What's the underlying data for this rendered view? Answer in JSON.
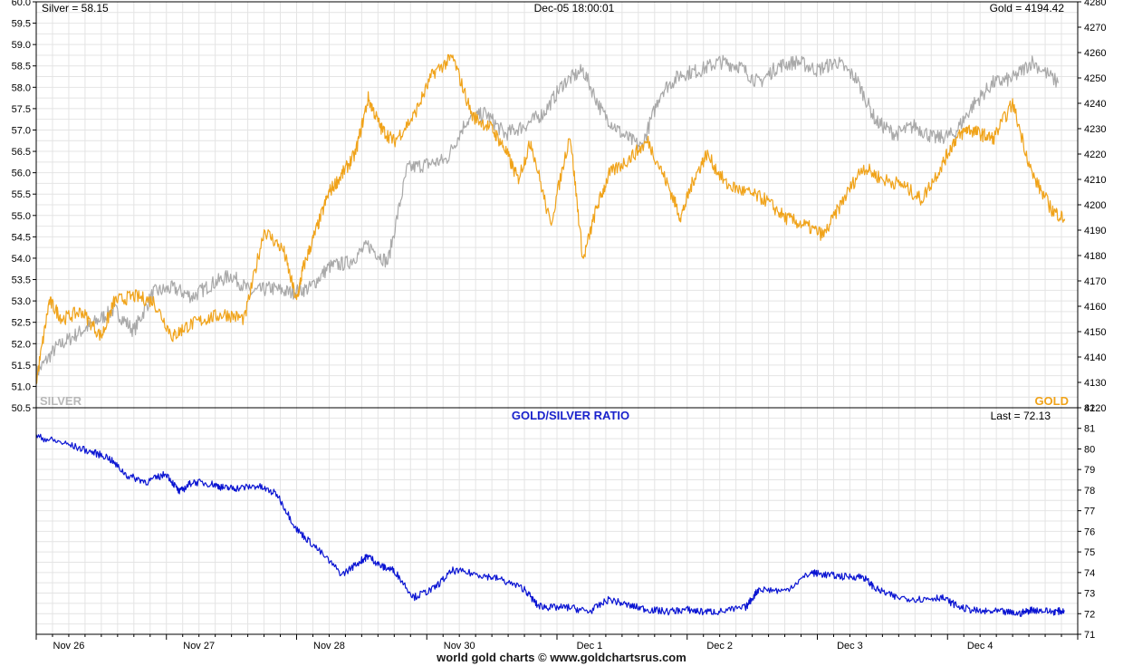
{
  "header": {
    "silver_readout": "Silver = 58.15",
    "timestamp": "Dec-05  18:00:01",
    "gold_readout": "Gold = 4194.42"
  },
  "footer": {
    "credit": "world gold charts © www.goldchartsrus.com"
  },
  "colors": {
    "silver": "#a9a9a9",
    "gold": "#f0a31a",
    "ratio": "#0a14d2",
    "ratio_title": "#1a22cc",
    "grid": "#e4e4e4"
  },
  "chart_data": [
    {
      "type": "line",
      "series": [
        {
          "name": "SILVER",
          "axis": "left",
          "x": [
            0,
            0.15,
            0.3,
            0.45,
            0.6,
            0.75,
            0.9,
            1.05,
            1.2,
            1.35,
            1.5,
            1.65,
            1.8,
            1.95,
            2.1,
            2.25,
            2.4,
            2.55,
            2.7,
            2.85,
            3.0,
            3.15,
            3.3,
            3.45,
            3.6,
            3.75,
            3.9,
            4.05,
            4.2,
            4.35,
            4.5,
            4.65,
            4.8,
            4.95,
            5.1,
            5.25,
            5.4,
            5.55,
            5.7,
            5.85,
            6.0,
            6.15,
            6.3,
            6.45,
            6.6,
            6.75,
            6.9,
            7.05,
            7.2,
            7.35,
            7.5,
            7.65,
            7.85
          ],
          "values": [
            51.3,
            51.9,
            52.2,
            52.5,
            52.8,
            52.3,
            53.2,
            53.3,
            53.1,
            53.4,
            53.6,
            53.2,
            53.3,
            53.2,
            53.3,
            53.8,
            53.9,
            54.3,
            53.9,
            56.1,
            56.2,
            56.3,
            57.2,
            57.4,
            56.9,
            57.1,
            57.4,
            58.1,
            58.4,
            57.4,
            56.9,
            56.6,
            57.9,
            58.3,
            58.4,
            58.6,
            58.5,
            58.1,
            58.5,
            58.6,
            58.4,
            58.6,
            58.2,
            57.2,
            56.9,
            57.1,
            56.8,
            56.9,
            57.6,
            58.1,
            58.2,
            58.6,
            58.1
          ]
        },
        {
          "name": "GOLD",
          "axis": "right",
          "x": [
            0,
            0.1,
            0.2,
            0.35,
            0.5,
            0.6,
            0.75,
            0.9,
            1.05,
            1.15,
            1.3,
            1.45,
            1.6,
            1.75,
            1.9,
            2.0,
            2.05,
            2.15,
            2.25,
            2.35,
            2.45,
            2.55,
            2.65,
            2.75,
            2.9,
            3.05,
            3.2,
            3.35,
            3.5,
            3.6,
            3.7,
            3.8,
            3.95,
            4.1,
            4.2,
            4.3,
            4.4,
            4.55,
            4.7,
            4.85,
            4.95,
            5.05,
            5.15,
            5.3,
            5.45,
            5.6,
            5.75,
            5.9,
            6.05,
            6.2,
            6.35,
            6.5,
            6.65,
            6.8,
            6.95,
            7.05,
            7.15,
            7.25,
            7.35,
            7.5,
            7.65,
            7.8,
            7.9
          ],
          "values": [
            4130,
            4162,
            4155,
            4158,
            4148,
            4162,
            4164,
            4162,
            4148,
            4152,
            4155,
            4157,
            4155,
            4190,
            4182,
            4162,
            4175,
            4190,
            4205,
            4212,
            4220,
            4242,
            4230,
            4225,
            4235,
            4252,
            4258,
            4235,
            4230,
            4222,
            4210,
            4225,
            4192,
            4228,
            4178,
            4198,
            4212,
            4218,
            4225,
            4208,
            4195,
            4210,
            4220,
            4208,
            4205,
            4202,
            4195,
            4192,
            4188,
            4202,
            4215,
            4210,
            4208,
            4202,
            4215,
            4225,
            4230,
            4228,
            4226,
            4240,
            4212,
            4198,
            4194.42
          ]
        }
      ],
      "series_labels": {
        "left": "SILVER",
        "right": "GOLD"
      },
      "x_start": "Nov 26",
      "x_ticks": [
        "Nov 26",
        "Nov 27",
        "Nov 28",
        "Nov 30",
        "Dec 1",
        "Dec 2",
        "Dec 3",
        "Dec 4"
      ],
      "x_range": [
        0,
        8
      ],
      "ylim_left": [
        50.5,
        60.0
      ],
      "ylim_right": [
        4120,
        4280
      ],
      "y_ticks_left": [
        "50.5",
        "51.0",
        "51.5",
        "52.0",
        "52.5",
        "53.0",
        "53.5",
        "54.0",
        "54.5",
        "55.0",
        "55.5",
        "56.0",
        "56.5",
        "57.0",
        "57.5",
        "58.0",
        "58.5",
        "59.0",
        "59.5",
        "60.0"
      ],
      "y_ticks_right": [
        "4120",
        "4130",
        "4140",
        "4150",
        "4160",
        "4170",
        "4180",
        "4190",
        "4200",
        "4210",
        "4220",
        "4230",
        "4240",
        "4250",
        "4260",
        "4270",
        "4280"
      ],
      "grid": true
    },
    {
      "type": "line",
      "title": "GOLD/SILVER RATIO",
      "last_label": "Last = 72.13",
      "series": [
        {
          "name": "GOLD/SILVER RATIO",
          "x": [
            0,
            0.2,
            0.4,
            0.55,
            0.7,
            0.85,
            1.0,
            1.1,
            1.2,
            1.35,
            1.45,
            1.55,
            1.7,
            1.85,
            2.0,
            2.15,
            2.35,
            2.5,
            2.55,
            2.65,
            2.75,
            2.9,
            3.05,
            3.2,
            3.4,
            3.55,
            3.75,
            3.85,
            3.95,
            4.1,
            4.25,
            4.4,
            4.55,
            4.7,
            4.85,
            5.0,
            5.1,
            5.25,
            5.45,
            5.55,
            5.75,
            5.95,
            6.05,
            6.2,
            6.35,
            6.45,
            6.6,
            6.8,
            6.95,
            7.1,
            7.25,
            7.4,
            7.55,
            7.65,
            7.8,
            7.9
          ],
          "values": [
            80.6,
            80.3,
            79.9,
            79.6,
            78.7,
            78.4,
            78.8,
            77.9,
            78.4,
            78.3,
            78.1,
            78.1,
            78.2,
            77.8,
            76.1,
            75.2,
            73.9,
            74.6,
            74.8,
            74.3,
            74.1,
            72.8,
            73.2,
            74.1,
            73.9,
            73.7,
            73.2,
            72.4,
            72.3,
            72.3,
            72.1,
            72.7,
            72.4,
            72.2,
            72.1,
            72.2,
            72.1,
            72.1,
            72.3,
            73.2,
            73.1,
            74.0,
            73.9,
            73.8,
            73.8,
            73.2,
            72.8,
            72.7,
            72.8,
            72.3,
            72.1,
            72.1,
            72.0,
            72.2,
            72.1,
            72.13
          ]
        }
      ],
      "x_ticks": [
        "Nov 26",
        "Nov 27",
        "Nov 28",
        "Nov 30",
        "Dec 1",
        "Dec 2",
        "Dec 3",
        "Dec 4"
      ],
      "x_range": [
        0,
        8
      ],
      "ylim": [
        71,
        82
      ],
      "y_ticks": [
        "71",
        "72",
        "73",
        "74",
        "75",
        "76",
        "77",
        "78",
        "79",
        "80",
        "81",
        "82"
      ],
      "grid": true
    }
  ]
}
